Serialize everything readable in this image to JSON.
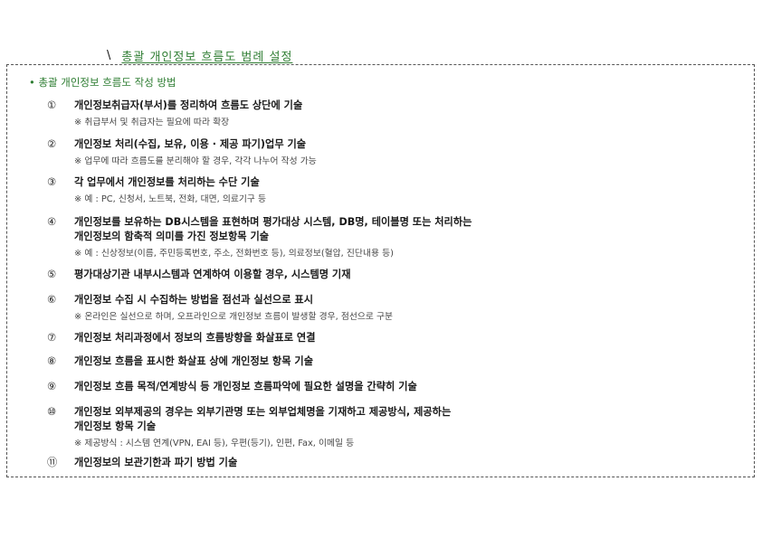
{
  "heading": {
    "mark": "\\",
    "text": "총괄 개인정보 흐름도 범례 설정"
  },
  "box": {
    "title": "• 총괄 개인정보 흐름도 작성 방법",
    "items": [
      {
        "num": "①",
        "lines": [
          "개인정보취급자(부서)를 정리하여 흐름도 상단에 기술"
        ],
        "note": "※ 취급부서 및 취급자는 필요에 따라 확장"
      },
      {
        "num": "②",
        "lines": [
          "개인정보 처리(수집, 보유, 이용 · 제공 파기)업무 기술"
        ],
        "note": "※ 업무에 따라 흐름도를 분리해야 할 경우, 각각 나누어 작성 가능"
      },
      {
        "num": "③",
        "lines": [
          "각 업무에서 개인정보를 처리하는 수단 기술"
        ],
        "note": "※ 예 : PC, 신청서, 노트북, 전화, 대면, 의료기구 등"
      },
      {
        "num": "④",
        "lines": [
          "개인정보를 보유하는 DB시스템을 표현하며 평가대상 시스템, DB명, 테이블명 또는 처리하는",
          "개인정보의 함축적 의미를 가진 정보항목 기술"
        ],
        "note": "※ 예 : 신상정보(이름, 주민등록번호, 주소, 전화번호 등), 의료정보(혈압, 진단내용 등)"
      },
      {
        "num": "⑤",
        "lines": [
          "평가대상기관 내부시스템과 연계하여 이용할 경우, 시스템명 기재"
        ],
        "note": ""
      },
      {
        "num": "⑥",
        "lines": [
          "개인정보 수집 시 수집하는 방법을 점선과 실선으로 표시"
        ],
        "note": "※ 온라인은 실선으로 하며, 오프라인으로 개인정보 흐름이 발생할 경우, 점선으로 구분"
      },
      {
        "num": "⑦",
        "lines": [
          "개인정보 처리과정에서 정보의 흐름방향을 화살표로 연결"
        ],
        "note": ""
      },
      {
        "num": "⑧",
        "lines": [
          "개인정보 흐름을 표시한 화살표 상에 개인정보 항목 기술"
        ],
        "note": ""
      },
      {
        "num": "⑨",
        "lines": [
          "개인정보 흐름 목적/연계방식 등 개인정보 흐름파악에 필요한 설명을 간략히 기술"
        ],
        "note": ""
      },
      {
        "num": "⑩",
        "lines": [
          "개인정보 외부제공의 경우는 외부기관명 또는 외부업체명을 기재하고 제공방식, 제공하는",
          "개인정보 항목 기술"
        ],
        "note": "※ 제공방식 : 시스템 연계(VPN, EAI 등), 우편(등기), 인편, Fax, 이메일 등"
      },
      {
        "num": "⑪",
        "lines": [
          "개인정보의 보관기한과 파기 방법 기술"
        ],
        "note": ""
      }
    ]
  }
}
